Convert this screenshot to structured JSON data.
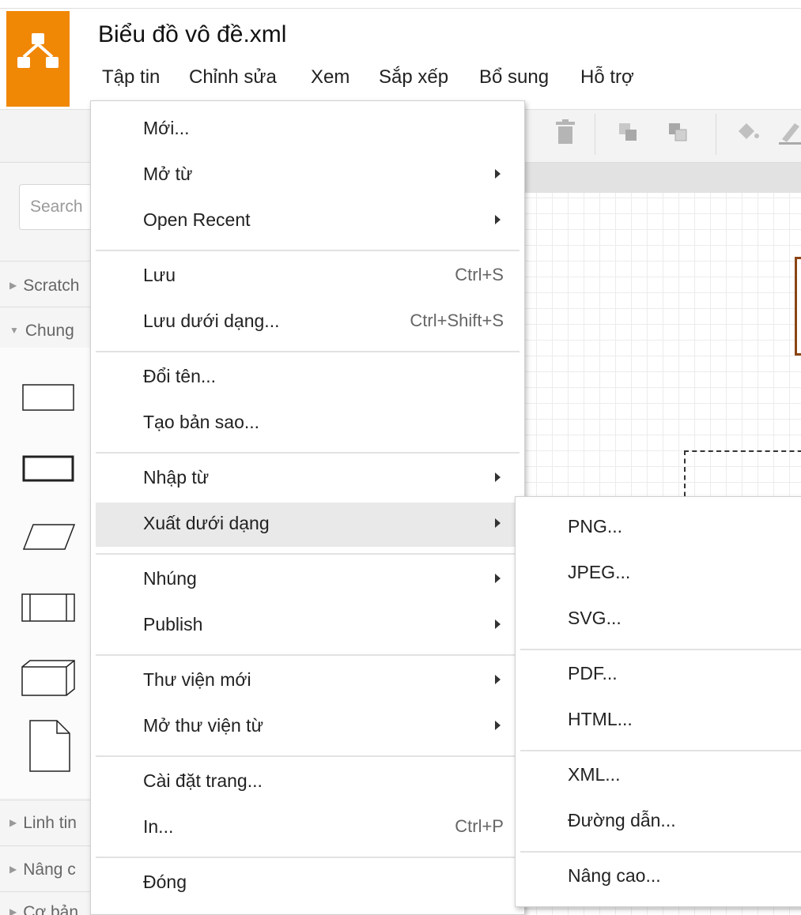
{
  "app": {
    "doc_title": "Biểu đồ vô đề.xml",
    "brand_color": "#f08705"
  },
  "menubar": [
    "Tập tin",
    "Chỉnh sửa",
    "Xem",
    "Sắp xếp",
    "Bổ sung",
    "Hỗ trợ"
  ],
  "sidebar": {
    "search_placeholder": "Search",
    "sections": [
      "Scratch",
      "Chung",
      "Linh tin",
      "Nâng c",
      "Cơ bản"
    ]
  },
  "file_menu": {
    "items": [
      {
        "label": "Mới...",
        "shortcut": "",
        "submenu": false
      },
      {
        "label": "Mở từ",
        "shortcut": "",
        "submenu": true
      },
      {
        "label": "Open Recent",
        "shortcut": "",
        "submenu": true
      },
      {
        "label": "Lưu",
        "shortcut": "Ctrl+S",
        "submenu": false
      },
      {
        "label": "Lưu dưới dạng...",
        "shortcut": "Ctrl+Shift+S",
        "submenu": false
      },
      {
        "label": "Đổi tên...",
        "shortcut": "",
        "submenu": false
      },
      {
        "label": "Tạo bản sao...",
        "shortcut": "",
        "submenu": false
      },
      {
        "label": "Nhập từ",
        "shortcut": "",
        "submenu": true
      },
      {
        "label": "Xuất dưới dạng",
        "shortcut": "",
        "submenu": true,
        "highlighted": true
      },
      {
        "label": "Nhúng",
        "shortcut": "",
        "submenu": true
      },
      {
        "label": "Publish",
        "shortcut": "",
        "submenu": true
      },
      {
        "label": "Thư viện mới",
        "shortcut": "",
        "submenu": true
      },
      {
        "label": "Mở thư viện từ",
        "shortcut": "",
        "submenu": true
      },
      {
        "label": "Cài đặt trang...",
        "shortcut": "",
        "submenu": false
      },
      {
        "label": "In...",
        "shortcut": "Ctrl+P",
        "submenu": false
      },
      {
        "label": "Đóng",
        "shortcut": "",
        "submenu": false
      }
    ]
  },
  "export_submenu": {
    "items": [
      "PNG...",
      "JPEG...",
      "SVG...",
      "PDF...",
      "HTML...",
      "XML...",
      "Đường dẫn...",
      "Nâng cao..."
    ]
  }
}
